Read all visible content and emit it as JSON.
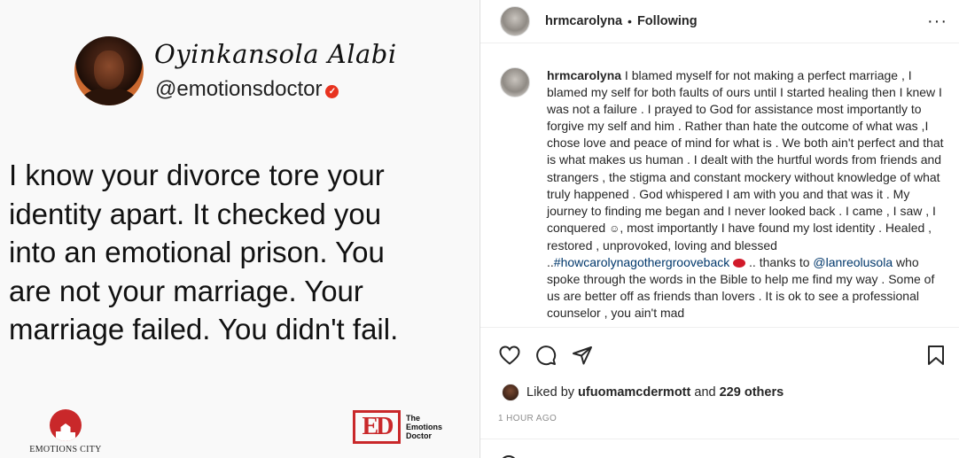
{
  "post_image": {
    "signature": "Oyinkansola Alabi",
    "handle": "@emotionsdoctor",
    "quote_lines": [
      "I know your divorce tore your",
      "identity apart. It checked you",
      "into an emotional prison. You",
      "are not your marriage. Your",
      "marriage failed. You didn't fail."
    ],
    "brand_left": "EMOTIONS CITY",
    "brand_right_mark": "ED",
    "brand_right_lines": [
      "The",
      "Emotions",
      "Doctor"
    ]
  },
  "header": {
    "username": "hrmcarolyna",
    "separator": "•",
    "follow_status": "Following",
    "more_icon": "more-horizontal-icon"
  },
  "caption": {
    "username": "hrmcarolyna",
    "text_part1": " I blamed myself for not making a perfect marriage , I blamed my self for both faults of ours until I started healing then I knew I was not a failure . I prayed to God for assistance most importantly to forgive my self and him . Rather than hate the outcome of what was ,I chose love and peace of mind for what is . We both ain't perfect and that is what makes us human . I dealt with the hurtful words from friends and strangers , the stigma and constant mockery without knowledge of what truly happened . God whispered I am with you and that was it . My journey to finding me began and I never looked back . I came , I saw , I conquered ",
    "smile_emoji": "☺",
    "text_part2": ", most importantly I have found my lost identity . Healed , restored , unprovoked, loving and blessed ..",
    "hashtag": "#howcarolynagothergrooveback",
    "text_part3": " .. thanks to ",
    "mention": "@lanreolusola",
    "text_part4": " who spoke through the words in the Bible to help me find my way . Some of us are better off as friends than lovers . It is ok to see a professional counselor , you ain't mad"
  },
  "actions": {
    "like_icon": "heart-icon",
    "comment_icon": "comment-icon",
    "share_icon": "share-icon",
    "save_icon": "bookmark-icon"
  },
  "likes": {
    "prefix": "Liked by ",
    "user": "ufuomamcdermott",
    "middle": " and ",
    "others": "229 others"
  },
  "timestamp": "1 HOUR AGO"
}
